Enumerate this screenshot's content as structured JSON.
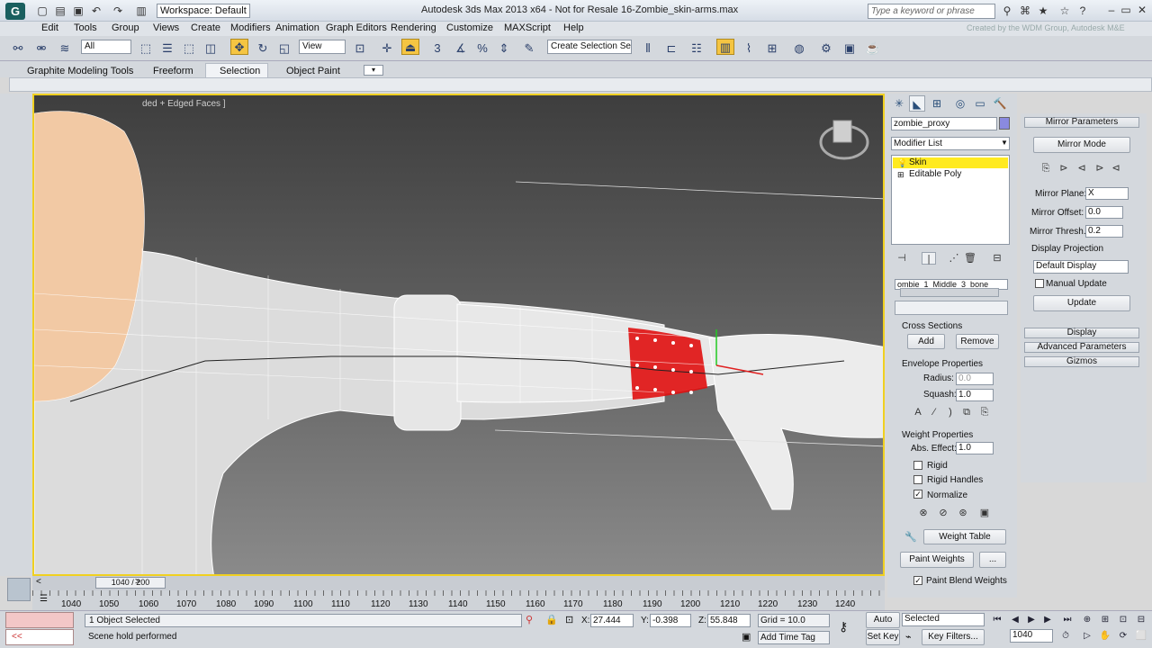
{
  "title_bar": {
    "logo": "G",
    "workspace": "Workspace: Default",
    "window_title": "Autodesk 3ds Max  2013 x64   -  Not for Resale   16-Zombie_skin-arms.max",
    "search_placeholder": "Type a keyword or phrase",
    "credit": "Created by the WDM Group, Autodesk M&E"
  },
  "menu": [
    "Edit",
    "Tools",
    "Group",
    "Views",
    "Create",
    "Modifiers",
    "Animation",
    "Graph Editors",
    "Rendering",
    "Customize",
    "MAXScript",
    "Help"
  ],
  "toolbar": {
    "selection_filter": "All",
    "ref_coord": "View",
    "named_selection": "Create Selection Se",
    "angle_snap": "3"
  },
  "ribbon": {
    "tabs": [
      "Graphite Modeling Tools",
      "Freeform",
      "Selection",
      "Object Paint"
    ],
    "active_tab": "Selection"
  },
  "viewport": {
    "label": "ded + Edged Faces ]"
  },
  "command_panel": {
    "object_name": "zombie_proxy",
    "modifier_list": "Modifier List",
    "stack": [
      "Skin",
      "Editable Poly"
    ],
    "bone_name": "ombie_1_Middle_3_bone",
    "cross_sections_label": "Cross Sections",
    "add_label": "Add",
    "remove_label": "Remove",
    "envelope_label": "Envelope Properties",
    "radius_label": "Radius:",
    "radius_value": "0.0",
    "squash_label": "Squash:",
    "squash_value": "1.0",
    "weight_props_label": "Weight Properties",
    "abs_effect_label": "Abs. Effect:",
    "abs_effect_value": "1.0",
    "rigid_label": "Rigid",
    "rigid_handles_label": "Rigid Handles",
    "normalize_label": "Normalize",
    "weight_table_label": "Weight Table",
    "paint_weights_label": "Paint Weights",
    "paint_more_label": "...",
    "paint_blend_label": "Paint Blend Weights"
  },
  "mirror_panel": {
    "header": "Mirror Parameters",
    "mirror_mode": "Mirror Mode",
    "mirror_plane_label": "Mirror Plane:",
    "mirror_plane_value": "X",
    "mirror_offset_label": "Mirror Offset:",
    "mirror_offset_value": "0.0",
    "mirror_thresh_label": "Mirror Thresh.:",
    "mirror_thresh_value": "0.2",
    "display_projection_label": "Display Projection",
    "display_projection_value": "Default Display",
    "manual_update_label": "Manual Update",
    "update_label": "Update",
    "rollouts": [
      "Display",
      "Advanced Parameters",
      "Gizmos"
    ]
  },
  "timeline": {
    "slider": "1040 / 200",
    "ticks": [
      "1040",
      "1050",
      "1060",
      "1070",
      "1080",
      "1090",
      "1100",
      "1110",
      "1120",
      "1130",
      "1140",
      "1150",
      "1160",
      "1170",
      "1180",
      "1190",
      "1200",
      "1210",
      "1220",
      "1230",
      "1240"
    ]
  },
  "status": {
    "selection": "1 Object Selected",
    "prompt": "Scene hold performed",
    "x_label": "X:",
    "x_value": "27.444",
    "y_label": "Y:",
    "y_value": "-0.398",
    "z_label": "Z:",
    "z_value": "55.848",
    "grid": "Grid = 10.0",
    "add_time_tag": "Add Time Tag",
    "auto_key": "Auto Key",
    "set_key": "Set Key",
    "selected": "Selected",
    "key_filters": "Key Filters...",
    "frame": "1040",
    "maxscript_arrows": "<<"
  }
}
